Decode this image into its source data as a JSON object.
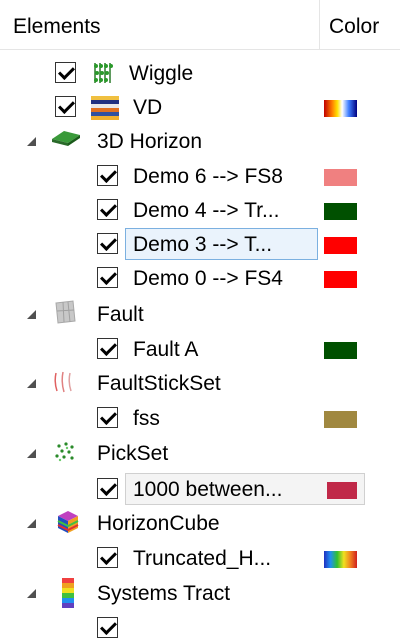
{
  "header": {
    "elements_label": "Elements",
    "color_label": "Color"
  },
  "rows": [
    {
      "label": "Wiggle",
      "icon": "wiggle-icon",
      "checked": true
    },
    {
      "label": "VD",
      "icon": "vd-colorbar-icon",
      "checked": true,
      "color": "gradient-vd"
    },
    {
      "label": "3D Horizon",
      "icon": "horizon-3d-icon",
      "expanded": true
    },
    {
      "label": "Demo 6 --> FS8",
      "checked": true,
      "color": "#f08080"
    },
    {
      "label": "Demo 4 --> Tr...",
      "checked": true,
      "color": "#005000"
    },
    {
      "label": "Demo 3  --> T...",
      "checked": true,
      "color": "#ff0000",
      "selected": true
    },
    {
      "label": "Demo 0 --> FS4",
      "checked": true,
      "color": "#ff0000"
    },
    {
      "label": "Fault",
      "icon": "fault-icon",
      "expanded": true
    },
    {
      "label": "Fault A",
      "checked": true,
      "color": "#005000"
    },
    {
      "label": "FaultStickSet",
      "icon": "faultstickset-icon",
      "expanded": true
    },
    {
      "label": "fss",
      "checked": true,
      "color": "#a08840"
    },
    {
      "label": "PickSet",
      "icon": "pickset-icon",
      "expanded": true
    },
    {
      "label": "1000 between...",
      "checked": true,
      "color": "#c02848",
      "hover": true
    },
    {
      "label": "HorizonCube",
      "icon": "horizoncube-icon",
      "expanded": true
    },
    {
      "label": "Truncated_H...",
      "checked": true,
      "color": "gradient-rainbow"
    },
    {
      "label": "Systems Tract",
      "icon": "systems-tract-icon",
      "expanded": true
    },
    {
      "label": "",
      "checked": true
    }
  ]
}
